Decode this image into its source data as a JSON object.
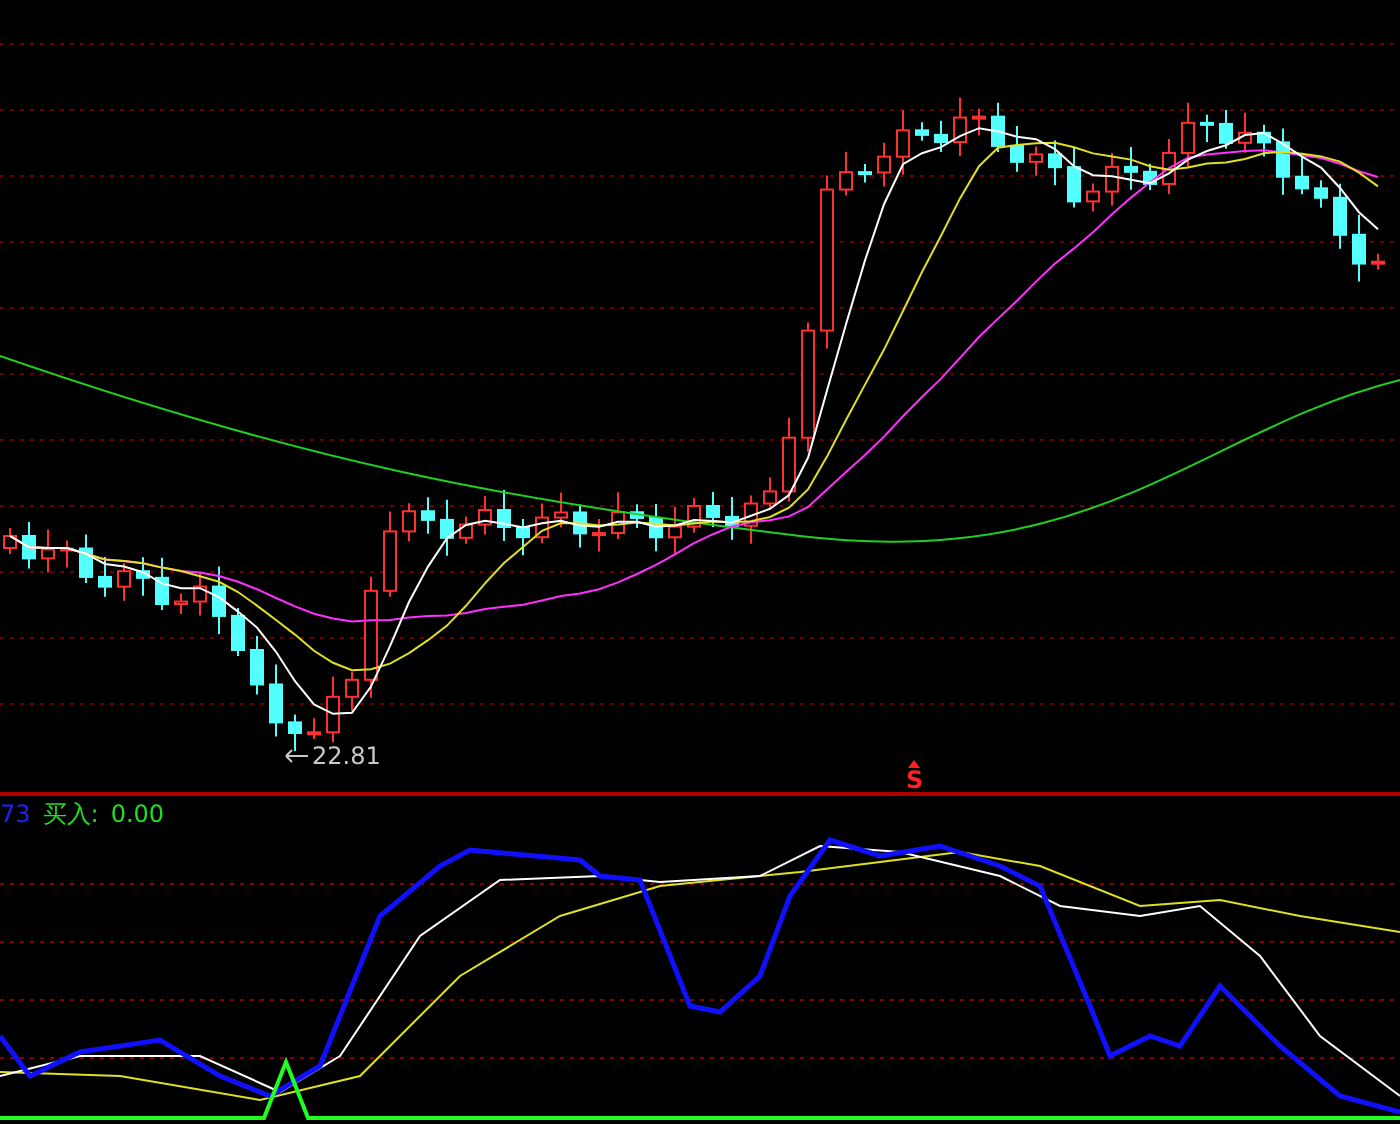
{
  "main_chart": {
    "low_label": "22.81",
    "signal_marker": "S"
  },
  "indicator_panel": {
    "cut_value": "73",
    "label": "买入:",
    "value": "0.00"
  }
}
